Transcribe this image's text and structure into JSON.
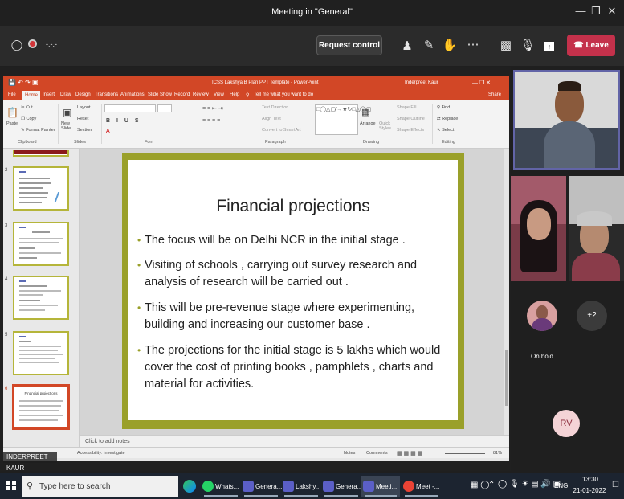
{
  "window": {
    "title": "Meeting in \"General\""
  },
  "toolbar": {
    "timer": "-:-:-",
    "request_control_label": "Request control",
    "leave_label": "Leave"
  },
  "ppt": {
    "title": "ICSS Lakshya B Plan PPT Template - PowerPoint",
    "user": "Inderpreet Kaur",
    "share": "Share",
    "tabs": [
      "File",
      "Home",
      "Insert",
      "Draw",
      "Design",
      "Transitions",
      "Animations",
      "Slide Show",
      "Record",
      "Review",
      "View",
      "Help"
    ],
    "tell_me": "Tell me what you want to do",
    "ribbon": {
      "paste": "Paste",
      "cut": "Cut",
      "copy": "Copy",
      "format_painter": "Format Painter",
      "clipboard": "Clipboard",
      "new_slide": "New Slide",
      "layout": "Layout",
      "reset": "Reset",
      "section": "Section",
      "slides": "Slides",
      "font": "Font",
      "text_direction": "Text Direction",
      "align_text": "Align Text",
      "convert_smartart": "Convert to SmartArt",
      "paragraph": "Paragraph",
      "arrange": "Arrange",
      "quick_styles": "Quick Styles",
      "shape_fill": "Shape Fill",
      "shape_outline": "Shape Outline",
      "shape_effects": "Shape Effects",
      "drawing": "Drawing",
      "find": "Find",
      "replace": "Replace",
      "select": "Select",
      "editing": "Editing"
    },
    "thumb_numbers": [
      "2",
      "3",
      "4",
      "5",
      "6"
    ],
    "thumb6_title": "Financial projections",
    "notes_placeholder": "Click to add notes",
    "status": {
      "accessibility": "Accessibility: Investigate",
      "notes": "Notes",
      "comments": "Comments",
      "zoom": "81%"
    }
  },
  "slide": {
    "title": "Financial projections",
    "bullets": [
      [
        "The focus will be on Delhi NCR in the initial stage ."
      ],
      [
        "Visiting of schools , carrying out survey research and",
        "analysis of research will be carried out ."
      ],
      [
        "This will be pre-revenue stage where experimenting,",
        "building and increasing our  customer base ."
      ],
      [
        "The projections for the initial stage is 5 lakhs  which would",
        "cover the cost of printing books , pamphlets , charts and",
        "material for activities."
      ]
    ]
  },
  "presenter_tag": "INDERPREET KAUR",
  "participants": {
    "on_hold_label": "On hold",
    "more_count": "+2",
    "initials": "RV"
  },
  "taskbar": {
    "search_placeholder": "Type here to search",
    "apps": [
      {
        "label": "Whats...",
        "color": "#25d366"
      },
      {
        "label": "Genera...",
        "color": "#5b5fc7"
      },
      {
        "label": "Lakshy...",
        "color": "#5b5fc7"
      },
      {
        "label": "Genera...",
        "color": "#5b5fc7"
      },
      {
        "label": "Meeti...",
        "color": "#5b5fc7"
      },
      {
        "label": "Meet -...",
        "color": "#ea4335"
      }
    ],
    "lang": "ENG",
    "time": "13:30",
    "date": "21-01-2022"
  }
}
